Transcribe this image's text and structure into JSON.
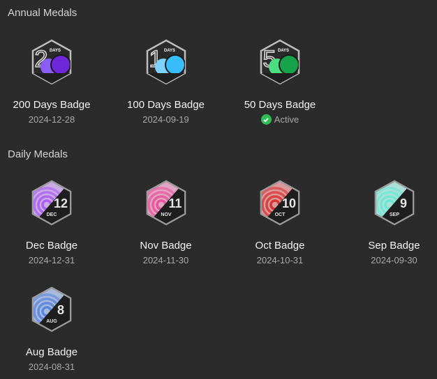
{
  "annual": {
    "title": "Annual Medals",
    "items": [
      {
        "label": "200 Days Badge",
        "sub": "2024-12-28",
        "days": "2",
        "color1": "#8b5cf6",
        "color2": "#6d28d9"
      },
      {
        "label": "100 Days Badge",
        "sub": "2024-09-19",
        "days": "1",
        "color1": "#7dd3fc",
        "color2": "#38bdf8"
      },
      {
        "label": "50 Days Badge",
        "sub": "Active",
        "active": true,
        "days": "5",
        "color1": "#4ade80",
        "color2": "#16a34a"
      }
    ]
  },
  "daily": {
    "title": "Daily Medals",
    "items": [
      {
        "label": "Dec Badge",
        "sub": "2024-12-31",
        "num": "12",
        "month": "DEC",
        "color": "#a855f7"
      },
      {
        "label": "Nov Badge",
        "sub": "2024-11-30",
        "num": "11",
        "month": "NOV",
        "color": "#ec4899"
      },
      {
        "label": "Oct Badge",
        "sub": "2024-10-31",
        "num": "10",
        "month": "OCT",
        "color": "#dc2626"
      },
      {
        "label": "Sep Badge",
        "sub": "2024-09-30",
        "num": "9",
        "month": "SEP",
        "color": "#5eead4"
      },
      {
        "label": "Aug Badge",
        "sub": "2024-08-31",
        "num": "8",
        "month": "AUG",
        "color": "#4f7fe0"
      }
    ]
  },
  "icons": {
    "active": "check-circle-icon",
    "badge": "hexagon-medal-icon"
  },
  "static_text": {
    "days": "DAYS"
  }
}
